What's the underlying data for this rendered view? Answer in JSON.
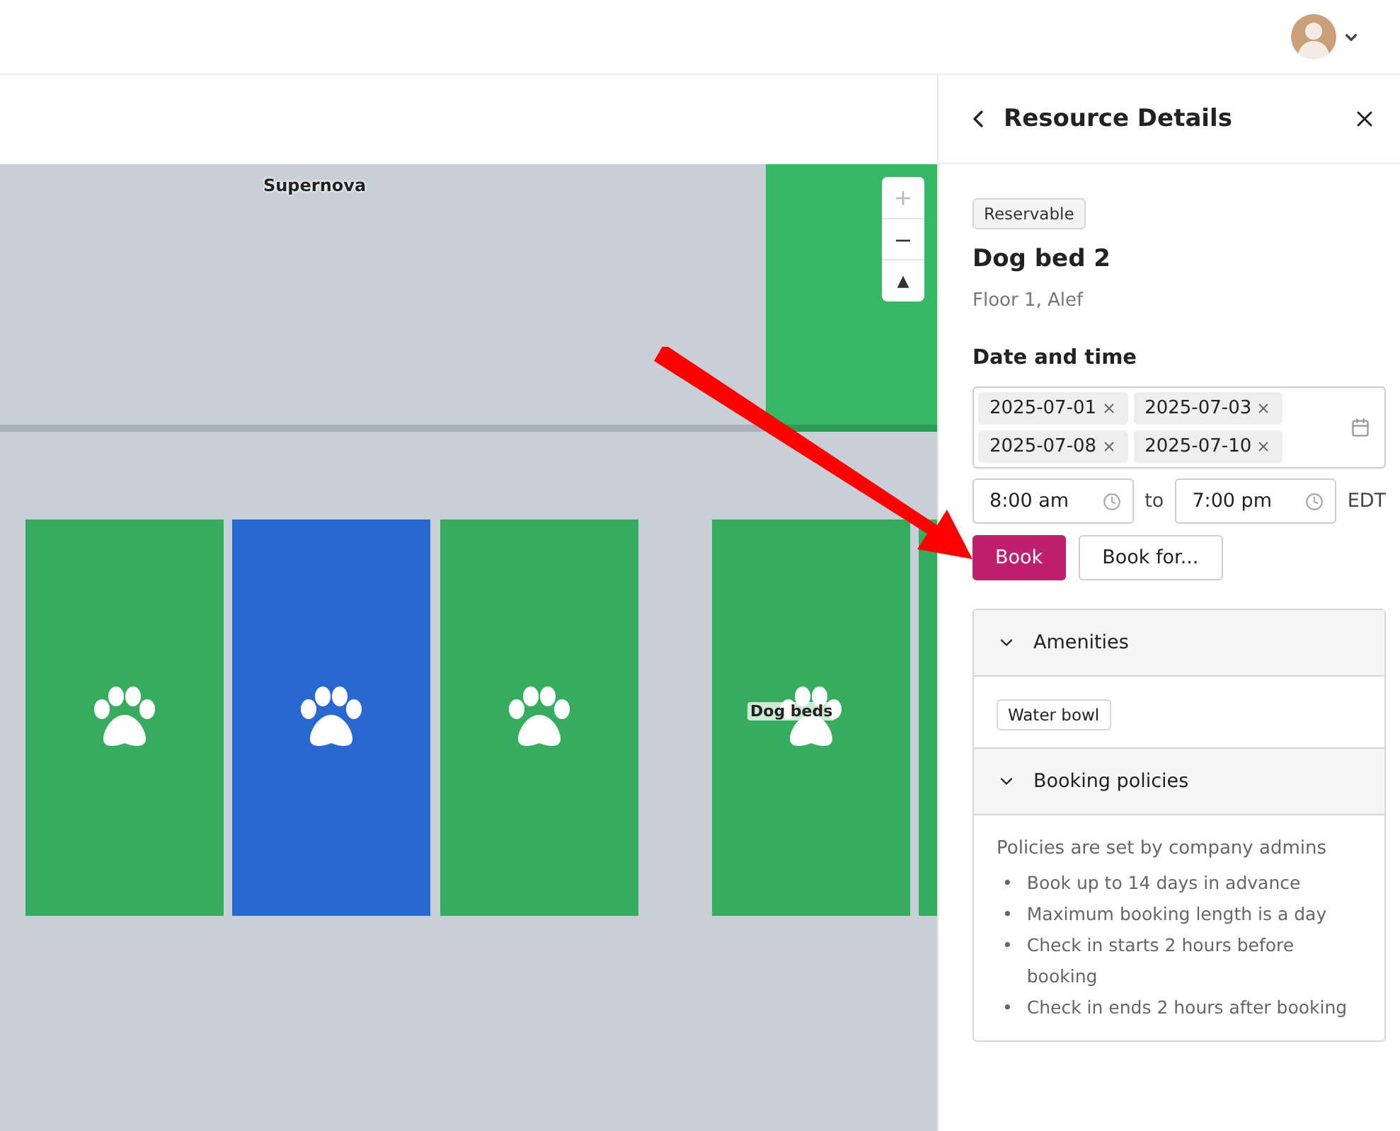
{
  "map": {
    "room_labels": [
      {
        "text": "Supernova"
      }
    ],
    "rooms": [
      {
        "kind": "gray"
      },
      {
        "kind": "green"
      }
    ],
    "desks": [
      {
        "color": "#36ad5e"
      },
      {
        "color": "#2769d1"
      },
      {
        "color": "#36ad5e"
      },
      {
        "color": "#36ad5e",
        "label": "Dog beds"
      },
      {
        "color": "#36ad5e"
      }
    ],
    "zoom": {
      "plus": "+",
      "minus": "−",
      "compass": "▲"
    }
  },
  "panel": {
    "title": "Resource Details",
    "badge": "Reservable",
    "name": "Dog bed 2",
    "location": "Floor 1, Alef",
    "date_heading": "Date and time",
    "dates": [
      "2025-07-01",
      "2025-07-03",
      "2025-07-08",
      "2025-07-10"
    ],
    "start_time": "8:00 am",
    "to": "to",
    "end_time": "7:00 pm",
    "timezone": "EDT",
    "buttons": [
      {
        "label": "Book",
        "kind": "primary"
      },
      {
        "label": "Book for...",
        "kind": "secondary"
      }
    ],
    "sections": [
      {
        "title": "Amenities",
        "expanded": true,
        "kind": "tags",
        "tags": [
          "Water bowl"
        ]
      },
      {
        "title": "Booking policies",
        "expanded": true,
        "kind": "policies",
        "intro": "Policies are set by company admins",
        "items": [
          {
            "marker": "•",
            "text": "Book up to 14 days in advance"
          },
          {
            "marker": "•",
            "text": "Maximum booking length is a day"
          },
          {
            "marker": "•",
            "text": "Check in starts 2 hours before booking"
          },
          {
            "marker": "•",
            "text": "Check in ends 2 hours after booking"
          }
        ]
      }
    ]
  }
}
